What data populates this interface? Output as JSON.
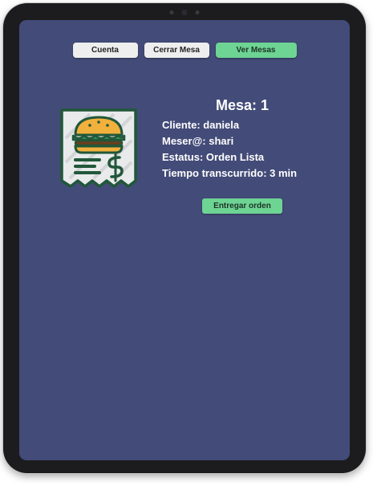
{
  "nav": {
    "cuenta_label": "Cuenta",
    "cerrar_mesa_label": "Cerrar Mesa",
    "ver_mesas_label": "Ver Mesas"
  },
  "table": {
    "title": "Mesa: 1",
    "cliente_label": "Cliente",
    "cliente_value": "daniela",
    "mesero_label": "Meser@",
    "mesero_value": "shari",
    "estatus_label": "Estatus",
    "estatus_value": "Orden Lista",
    "tiempo_label": "Tiempo transcurrido",
    "tiempo_value": "3 min"
  },
  "actions": {
    "entregar_label": "Entregar orden"
  },
  "icons": {
    "order": "burger-receipt-icon"
  },
  "colors": {
    "screen_bg": "#434b78",
    "accent_green": "#6dd494",
    "button_light": "#eeeeee",
    "text_light": "#ffffff"
  }
}
